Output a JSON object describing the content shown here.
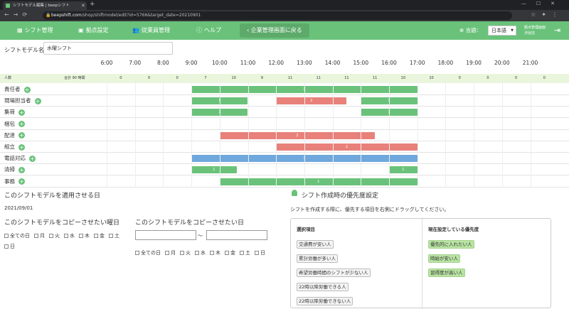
{
  "browser": {
    "tab_title": "シフトモデル編集 | beepシフト",
    "url_host": "beepshift.com",
    "url_path": "/shop/shiftmodel/edit?id=5766&target_date=20210901"
  },
  "nav": {
    "items": [
      {
        "label": "シフト管理",
        "icon": "calendar-icon"
      },
      {
        "label": "拠点設定",
        "icon": "building-icon"
      },
      {
        "label": "従業員管理",
        "icon": "people-icon"
      },
      {
        "label": "ヘルプ",
        "icon": "info-icon"
      }
    ],
    "back_label": "企業管理画面に戻る",
    "lang_label": "言語：",
    "lang_value": "日本語",
    "store_line1": "拠点管理画面",
    "store_line2": "渋谷店"
  },
  "model": {
    "label": "シフトモデル名",
    "value": "水曜シフト"
  },
  "hours": [
    "6:00",
    "7:00",
    "8:00",
    "9:00",
    "10:00",
    "11:00",
    "12:00",
    "13:00",
    "14:00",
    "15:00",
    "16:00",
    "17:00",
    "18:00",
    "19:00",
    "20:00",
    "21:00"
  ],
  "counts": {
    "label": "人数",
    "total": "合計 90 時間",
    "values": [
      "0",
      "0",
      "0",
      "7",
      "10",
      "9",
      "11",
      "11",
      "11",
      "11",
      "10",
      "10",
      "0",
      "0",
      "0",
      "0"
    ]
  },
  "rows": [
    {
      "label": "責任者",
      "bars": [
        {
          "start": 9,
          "end": 17,
          "n": "1",
          "color": "green"
        }
      ]
    },
    {
      "label": "現場担当者",
      "bars": [
        {
          "start": 9,
          "end": 11,
          "n": "1",
          "color": "green"
        },
        {
          "start": 12,
          "end": 14.5,
          "n": "2",
          "color": "red"
        },
        {
          "start": 15,
          "end": 17,
          "n": "1",
          "color": "green"
        }
      ]
    },
    {
      "label": "集荷",
      "bars": [
        {
          "start": 9,
          "end": 11,
          "n": "1",
          "color": "green"
        },
        {
          "start": 15,
          "end": 17,
          "n": "1",
          "color": "green"
        }
      ]
    },
    {
      "label": "梱包",
      "bars": []
    },
    {
      "label": "配達",
      "bars": [
        {
          "start": 10,
          "end": 15.5,
          "n": "2",
          "color": "red"
        }
      ]
    },
    {
      "label": "組立",
      "bars": [
        {
          "start": 12,
          "end": 17,
          "n": "2",
          "color": "red"
        }
      ]
    },
    {
      "label": "電話対応",
      "bars": [
        {
          "start": 9,
          "end": 17,
          "n": "3",
          "color": "blue"
        }
      ]
    },
    {
      "label": "清掃",
      "bars": [
        {
          "start": 9,
          "end": 10.6,
          "n": "1",
          "color": "green"
        },
        {
          "start": 16,
          "end": 17,
          "n": "1",
          "color": "green"
        }
      ]
    },
    {
      "label": "事務",
      "bars": [
        {
          "start": 10,
          "end": 17,
          "n": "1",
          "color": "green"
        }
      ]
    }
  ],
  "colors": {
    "green": "#6ac27a",
    "red": "#e8817a",
    "blue": "#6fa8dc"
  },
  "apply": {
    "title": "このシフトモデルを適用させる日",
    "date": "2021/09/01"
  },
  "copy_week": {
    "title": "このシフトモデルをコピーさせたい曜日",
    "days": [
      "全ての日",
      "月",
      "火",
      "水",
      "木",
      "金",
      "土",
      "日"
    ]
  },
  "copy_date": {
    "title": "このシフトモデルをコピーさせたい日",
    "tilde": "～",
    "days": [
      "全ての日",
      "月",
      "火",
      "水",
      "木",
      "金",
      "土",
      "日"
    ]
  },
  "priority": {
    "title": "シフト作成時の優先度設定",
    "desc": "シフトを作成する際に、優先する項目を右側にドラッグしてください。",
    "left_header": "選択項目",
    "right_header": "現在設定している優先度",
    "left_items": [
      "交通費が安い人",
      "累計労働が多い人",
      "希望労働時間のシフトが少ない人",
      "22時以降労働できる人",
      "22時以降労働できない人"
    ],
    "right_items": [
      "優先的に入れたい人",
      "時給が安い人",
      "習得度が高い人"
    ]
  }
}
